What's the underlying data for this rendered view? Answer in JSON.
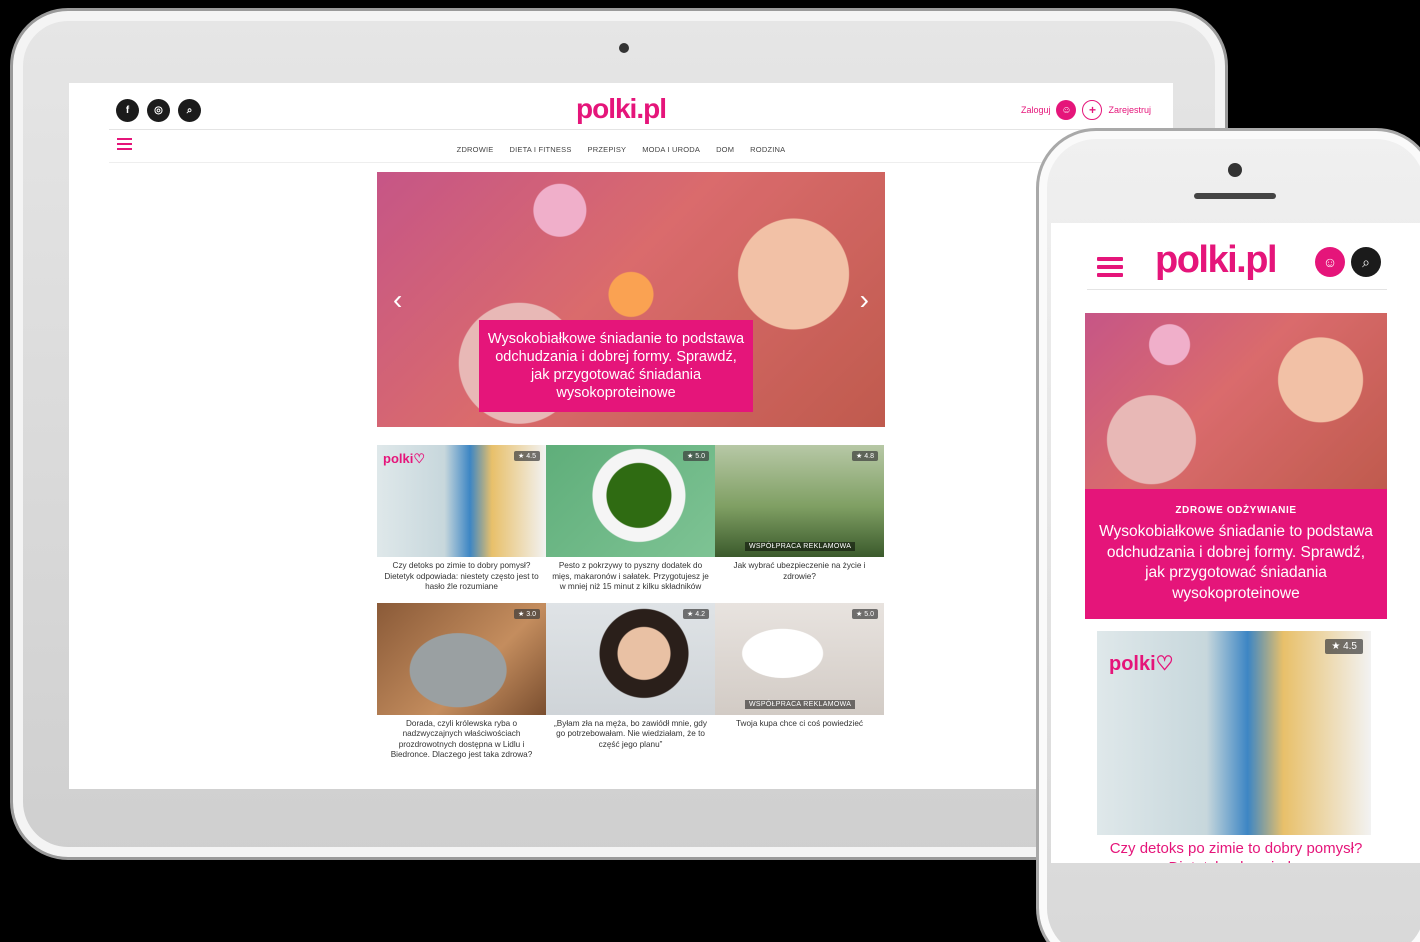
{
  "tablet": {
    "logo": "polki.pl",
    "social": {
      "facebook": "f",
      "instagram": "◎",
      "search": "⌕"
    },
    "account": {
      "login": "Zaloguj",
      "register": "Zarejestruj"
    },
    "nav": [
      "ZDROWIE",
      "DIETA I FITNESS",
      "PRZEPISY",
      "MODA I URODA",
      "DOM",
      "RODZINA"
    ],
    "hero": {
      "caption": "Wysokobiałkowe śniadanie to podstawa odchudzania i dobrej formy. Sprawdź, jak przygotować śniadania wysokoproteinowe",
      "prev": "‹",
      "next": "›"
    },
    "cards": [
      {
        "caption": "Czy detoks po zimie to dobry pomysł? Dietetyk odpowiada: niestety często jest to hasło źle rozumiane",
        "rating": "★ 4.5",
        "ad": ""
      },
      {
        "caption": "Pesto z pokrzywy to pyszny dodatek do mięs, makaronów i sałatek. Przygotujesz je w mniej niż 15 minut z kilku składników",
        "rating": "★ 5.0",
        "ad": ""
      },
      {
        "caption": "Jak wybrać ubezpieczenie na życie i zdrowie?",
        "rating": "★ 4.8",
        "ad": "WSPÓŁPRACA REKLAMOWA"
      },
      {
        "caption": "Dorada, czyli królewska ryba o nadzwyczajnych właściwościach prozdrowotnych dostępna w Lidlu i Biedronce. Dlaczego jest taka zdrowa?",
        "rating": "★ 3.0",
        "ad": ""
      },
      {
        "caption": "„Byłam zła na męża, bo zawiódł mnie, gdy go potrzebowałam. Nie wiedziałam, że to część jego planu”",
        "rating": "★ 4.2",
        "ad": ""
      },
      {
        "caption": "Twoja kupa chce ci coś powiedzieć",
        "rating": "★ 5.0",
        "ad": "WSPÓŁPRACA REKLAMOWA"
      }
    ]
  },
  "phone": {
    "logo": "polki.pl",
    "category": "ZDROWE ODŻYWIANIE",
    "hero_title": "Wysokobiałkowe śniadanie to podstawa odchudzania i dobrej formy. Sprawdź, jak przygotować śniadania wysokoproteinowe",
    "card_rating": "★ 4.5",
    "card_caption": "Czy detoks po zimie to dobry pomysł? Dietetyk odpowiada:"
  },
  "colors": {
    "brand": "#e5157a",
    "dark": "#1b1b1b"
  }
}
